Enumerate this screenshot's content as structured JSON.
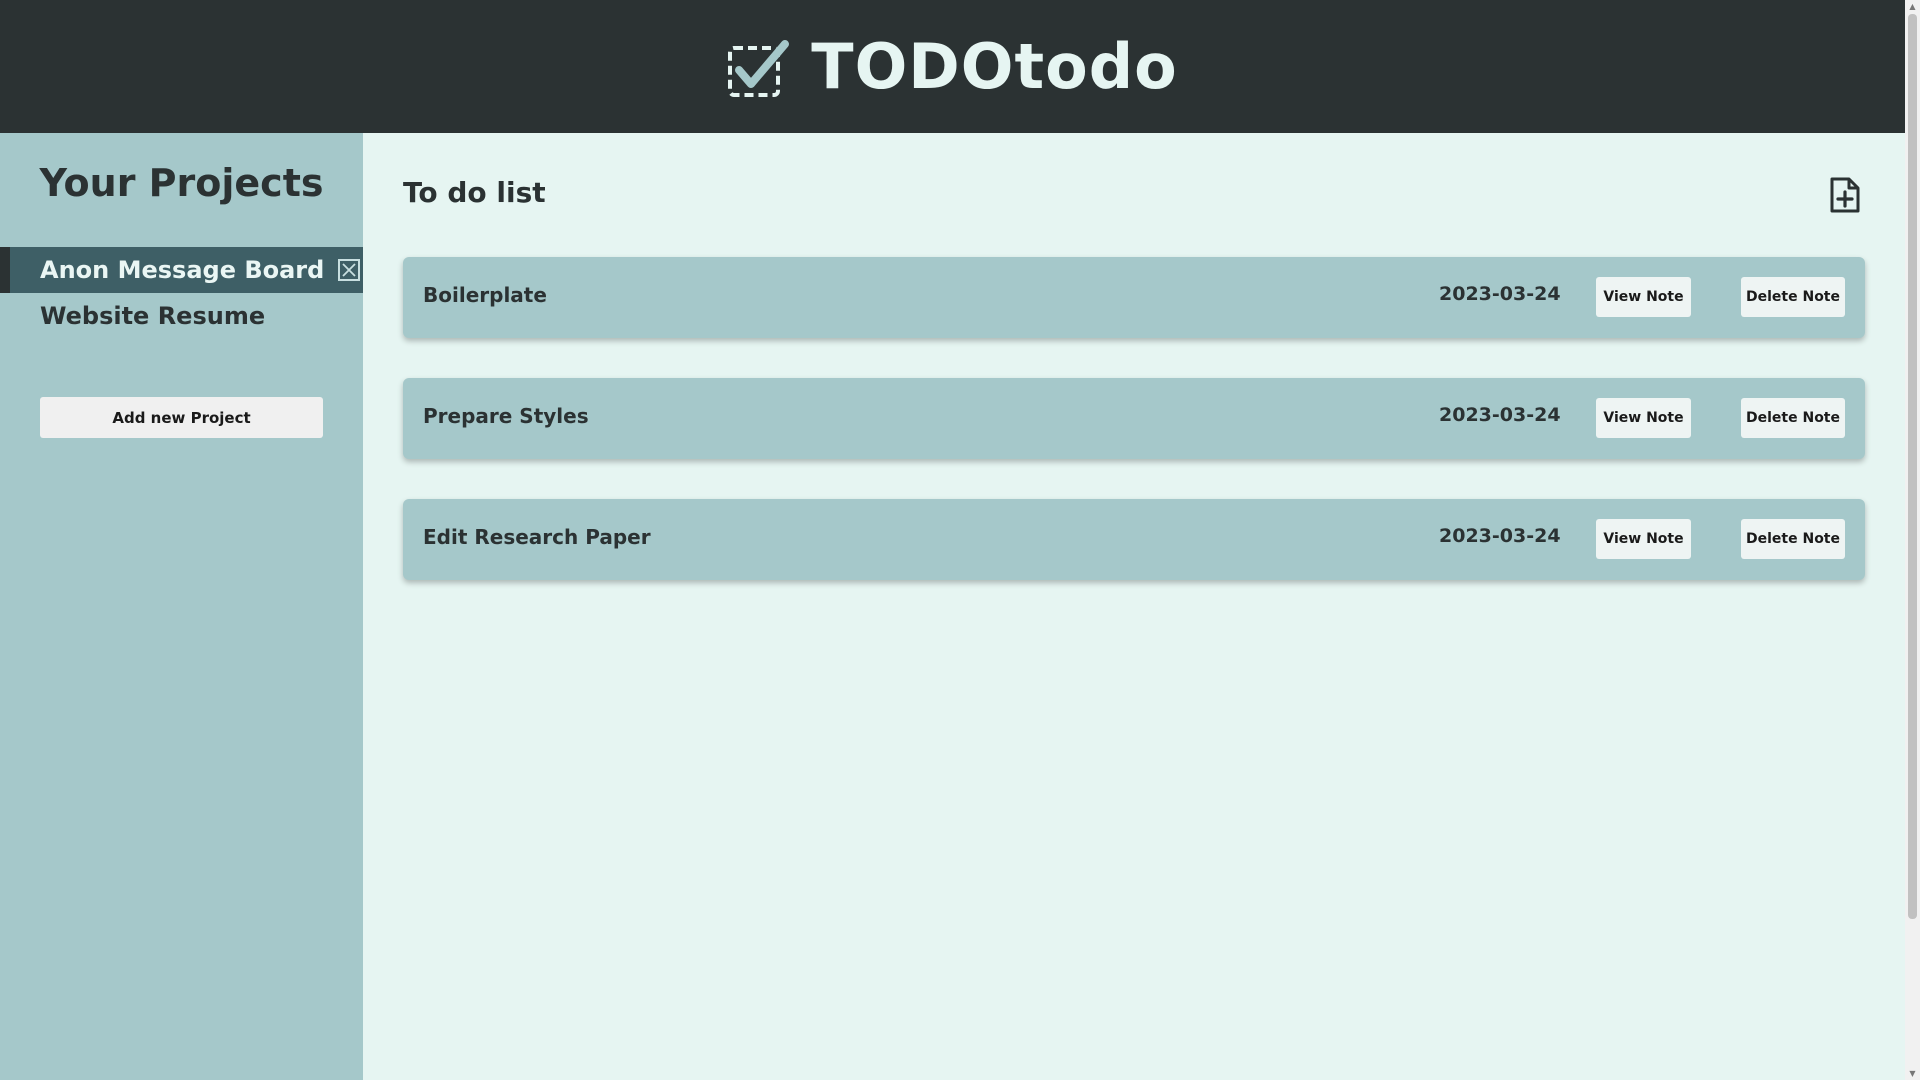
{
  "header": {
    "app_title": "TODOtodo",
    "logo_icon": "dashed-checkbox-icon"
  },
  "sidebar": {
    "title": "Your Projects",
    "projects": [
      {
        "label": "Anon Message Board",
        "active": true
      },
      {
        "label": "Website Resume",
        "active": false
      }
    ],
    "add_project_label": "Add new Project"
  },
  "main": {
    "title": "To do list",
    "add_note_icon": "file-plus-icon",
    "todos": [
      {
        "title": "Boilerplate",
        "date": "2023-03-24",
        "view_label": "View Note",
        "delete_label": "Delete Note"
      },
      {
        "title": "Prepare Styles",
        "date": "2023-03-24",
        "view_label": "View Note",
        "delete_label": "Delete Note"
      },
      {
        "title": "Edit Research Paper",
        "date": "2023-03-24",
        "view_label": "View Note",
        "delete_label": "Delete Note"
      }
    ]
  },
  "colors": {
    "header_bg": "#2b3233",
    "sidebar_bg": "#a5c8ca",
    "main_bg": "#e6f5f2",
    "active_project_bg": "#3e5f66",
    "card_bg": "#a5c8ca"
  }
}
